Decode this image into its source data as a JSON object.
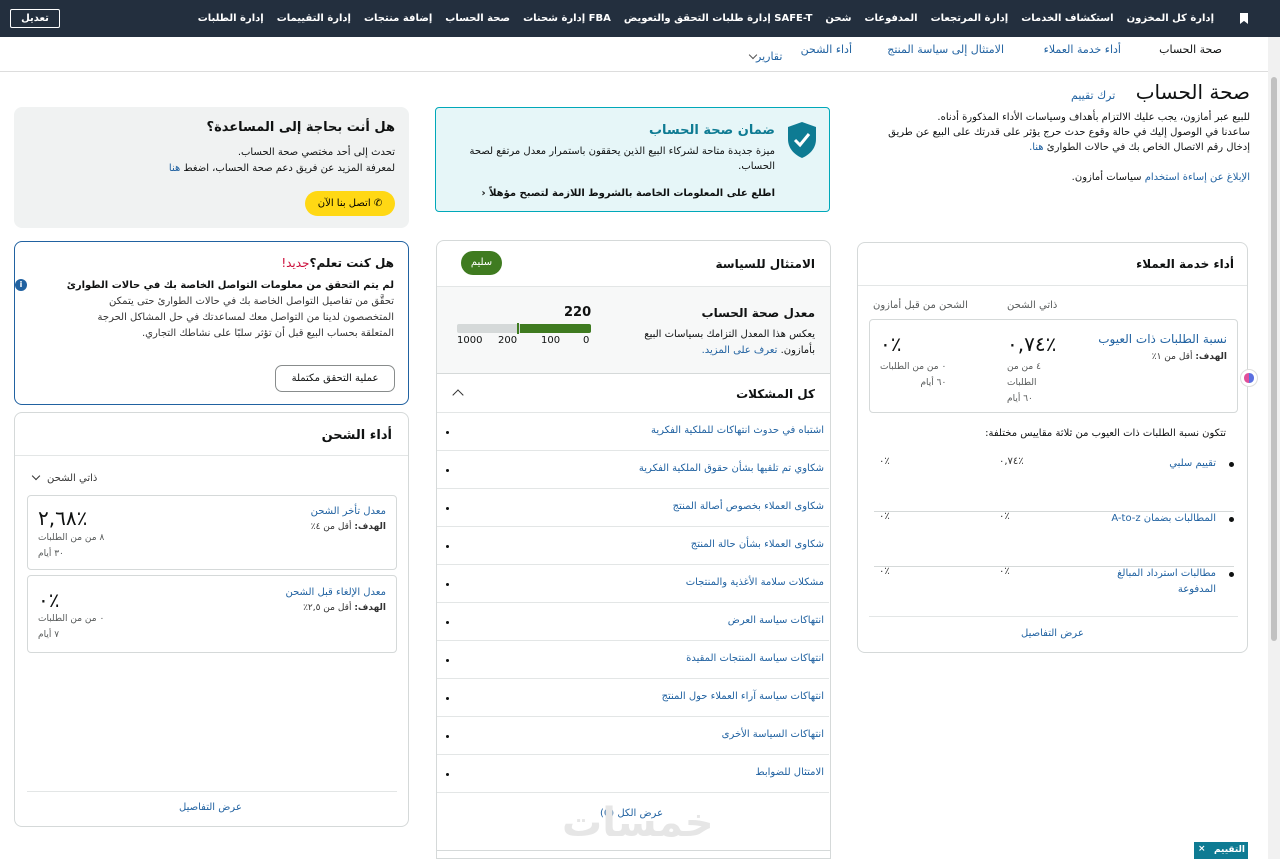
{
  "topbar": {
    "edit": "تعديل",
    "nav": [
      "إدارة كل المخزون",
      "استكشاف الخدمات",
      "إدارة المرتجعات",
      "المدفوعات",
      "شحن",
      "إدارة طلبات التحقق والتعويض SAFE-T",
      "إدارة شحنات FBA",
      "صحة الحساب",
      "إضافة منتجات",
      "إدارة التقييمات",
      "إدارة الطلبات"
    ]
  },
  "subnav": {
    "tabs": [
      "صحة الحساب",
      "أداء خدمة العملاء",
      "الامتثال إلى سياسة المنتج",
      "أداء الشحن",
      "تقارير"
    ]
  },
  "header": {
    "title": "صحة الحساب",
    "feedback": "ترك تقييم",
    "desc1": "للبيع عبر أمازون، يجب عليك الالتزام بأهداف وسياسات الأداء المذكورة أدناه.",
    "desc2": "ساعدنا في الوصول إليك في حالة وقوع حدث حرج يؤثر على قدرتك على البيع عن طريق",
    "desc3": "إدخال رقم الاتصال الخاص بك في حالات الطوارئ",
    "desc3_link": "هنا.",
    "report_link": "الإبلاغ عن إساءة استخدام",
    "report_rest": "سياسات أمازون."
  },
  "guarantee": {
    "title": "ضمان صحة الحساب",
    "desc": "ميزة جديدة متاحة لشركاء البيع الذين يحققون باستمرار معدل مرتفع لصحة الحساب.",
    "link": "اطلع على المعلومات الخاصة بالشروط اللازمة لتصبح مؤهلاً"
  },
  "help": {
    "title": "هل أنت بحاجة إلى المساعدة؟",
    "line1": "تحدث إلى أحد مختصي صحة الحساب.",
    "line2": "لمعرفة المزيد عن فريق دعم صحة الحساب، اضغط",
    "line2_link": "هنا",
    "button": "اتصل بنا الآن"
  },
  "didyouknow": {
    "title": "هل كنت تعلم؟",
    "new_badge": "جديد!",
    "bold": "لم يتم التحقق من معلومات التواصل الخاصة بك في حالات الطوارئ",
    "line1": "تحقَّق من تفاصيل التواصل الخاصة بك في حالات الطوارئ حتى يتمكن",
    "line2": "المتخصصون لدينا من التواصل معك لمساعدتك في حل المشاكل الحرجة",
    "line3": "المتعلقة بحساب البيع قبل أن تؤثر سلبًا على نشاطك التجاري.",
    "button": "عملية التحقق مكتملة"
  },
  "shipping": {
    "title": "أداء الشحن",
    "filter": "ذاتي الشحن",
    "late": {
      "label": "معدل تأخر الشحن",
      "target_label": "الهدف:",
      "target": "أقل من ٤٪",
      "value": "٢,٦٨٪",
      "orders": "٨ من من الطلبات",
      "days": "٣٠ أيام"
    },
    "cancel": {
      "label": "معدل الإلغاء قبل الشحن",
      "target_label": "الهدف:",
      "target": "أقل من ٢,٥٪",
      "value": "٠٪",
      "orders": "٠ من من الطلبات",
      "days": "٧ أيام"
    },
    "details": "عرض التفاصيل"
  },
  "policy": {
    "title": "الامتثال للسياسة",
    "status": "سليم",
    "ahr_title": "معدل صحة الحساب",
    "ahr_desc1": "يعكس هذا المعدل التزامك بسياسات البيع",
    "ahr_desc2": "بأمازون.",
    "ahr_link": "تعرف على المزيد.",
    "ahr_value": "220",
    "ahr_max": 1000,
    "ticks": [
      "1000",
      "200",
      "100",
      "0"
    ],
    "issues_title": "كل المشكلات",
    "issues": [
      "اشتباه في حدوث انتهاكات للملكية الفكرية",
      "شكاوي تم تلقيها بشأن حقوق الملكية الفكرية",
      "شكاوى العملاء بخصوص أصالة المنتج",
      "شكاوى العملاء بشأن حالة المنتج",
      "مشكلات سلامة الأغذية والمنتجات",
      "انتهاكات سياسة العرض",
      "انتهاكات سياسة المنتجات المقيدة",
      "انتهاكات سياسة آراء العملاء حول المنتج",
      "انتهاكات السياسة الأخرى",
      "الامتثال للضوابط"
    ],
    "view_all": "عرض الكل (0)"
  },
  "customer": {
    "title": "أداء خدمة العملاء",
    "col_self": "ذاتي الشحن",
    "col_fba": "الشحن من قبل أمازون",
    "odr_label": "نسبة الطلبات ذات العيوب",
    "target_label": "الهدف:",
    "target": "أقل من ١٪",
    "odr_self": "٠,٧٤٪",
    "odr_self_sub1": "٤ من من",
    "odr_self_sub2": "الطلبات",
    "odr_self_sub3": "٦٠ أيام",
    "odr_fba": "٠٪",
    "odr_fba_sub1": "٠ من من الطلبات",
    "odr_fba_sub2": "٦٠ أيام",
    "breakdown_intro": "تتكون نسبة الطلبات ذات العيوب من ثلاثة مقاييس مختلفة:",
    "rows": [
      {
        "label": "تقييم سلبي",
        "self": "٠,٧٤٪",
        "fba": "٠٪"
      },
      {
        "label": "المطالبات بضمان A-to-z",
        "self": "٠٪",
        "fba": "٠٪"
      },
      {
        "label": "مطالبات استرداد المبالغ المدفوعة",
        "self": "٠٪",
        "fba": "٠٪"
      }
    ],
    "details": "عرض التفاصيل"
  },
  "footer": {
    "feedback_btn": "التقييم",
    "watermark": "خمسات"
  },
  "colors": {
    "nav_bg": "#232f3e",
    "healthy_green": "#3f7b20",
    "help_yellow": "#ffd814",
    "guarantee_bg": "#e6f6f8",
    "guarantee_border": "#00a8b9",
    "new_red": "#cc0c39"
  }
}
